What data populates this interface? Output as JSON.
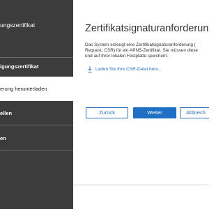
{
  "sidebar": {
    "steps": [
      {
        "label": "ungszertifikat"
      },
      {
        "label": "igungszertifikat"
      },
      {
        "label": "erung herunterladen"
      },
      {
        "label": "ellen"
      },
      {
        "label": "en"
      }
    ]
  },
  "main": {
    "title": "Zertifikatsignaturanforderung",
    "description_lines": [
      "Das System erzeugt eine Zertifikatsignaturanforderung (",
      "Request, CSR) für ein APNS-Zertifikat. Sie müssen diese",
      "und auf Ihrer lokalen Festplatte speichern."
    ],
    "download_link": "Laden Sie Ihre CSR-Datei heru..."
  },
  "buttons": {
    "back": "Zurück",
    "next": "Weiter",
    "cancel": "Abbrech"
  },
  "colors": {
    "sidebar_bg": "#3c3c3c",
    "accent": "#1f6fc5",
    "link": "#2a6ebb"
  }
}
